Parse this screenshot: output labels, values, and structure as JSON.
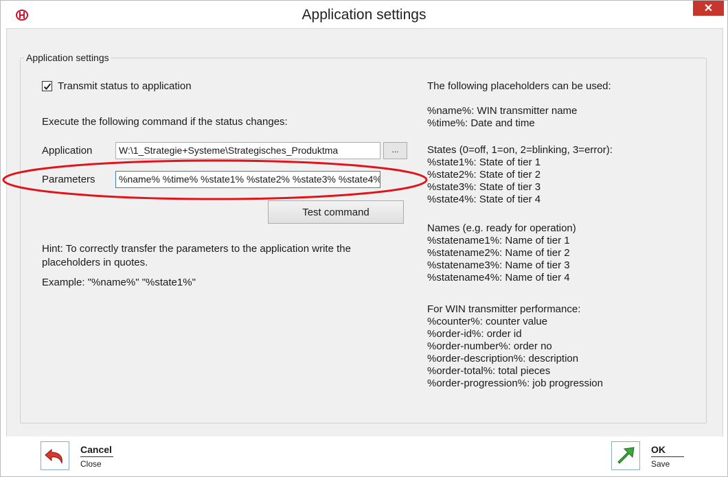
{
  "window": {
    "title": "Application settings",
    "close_glyph": "✕"
  },
  "group": {
    "legend": "Application settings"
  },
  "transmit": {
    "label": "Transmit status to application",
    "checked": true
  },
  "exec_label": "Execute the following command if the status changes:",
  "application": {
    "label": "Application",
    "value": "W:\\1_Strategie+Systeme\\Strategisches_Produktma",
    "browse_label": "..."
  },
  "parameters": {
    "label": "Parameters",
    "value": "%name% %time% %state1% %state2% %state3% %state4%"
  },
  "test_button": "Test command",
  "hint": "Hint: To correctly transfer the parameters to the application write the placeholders in quotes.",
  "example": "Example: \"%name%\" \"%state1%\"",
  "placeholders": {
    "intro": "The following placeholders can be used:",
    "general": [
      "%name%: WIN transmitter name",
      "%time%: Date and time"
    ],
    "states_title": "States (0=off, 1=on, 2=blinking, 3=error):",
    "states": [
      "%state1%: State of tier 1",
      "%state2%: State of tier 2",
      "%state3%: State of tier 3",
      "%state4%: State of tier 4"
    ],
    "names_title": "Names (e.g. ready for operation)",
    "names": [
      "%statename1%: Name of tier 1",
      "%statename2%: Name of tier 2",
      "%statename3%: Name of tier 3",
      "%statename4%: Name of tier 4"
    ],
    "perf_title": "For WIN transmitter performance:",
    "perf": [
      "%counter%: counter value",
      "%order-id%: order id",
      "%order-number%: order no",
      "%order-description%: description",
      "%order-total%: total pieces",
      "%order-progression%: job progression"
    ]
  },
  "footer": {
    "cancel_title": "Cancel",
    "cancel_sub": "Close",
    "ok_title": "OK",
    "ok_sub": "Save"
  },
  "colors": {
    "close_bg": "#c7362d",
    "annotation": "#e0151b",
    "ok_arrow": "#3aa83a",
    "cancel_arrow": "#d9362c"
  },
  "icons": {
    "logo": "werma-logo-icon",
    "close": "close-icon",
    "check": "checkmark-icon",
    "cancel": "undo-arrow-icon",
    "ok": "up-right-arrow-icon"
  }
}
